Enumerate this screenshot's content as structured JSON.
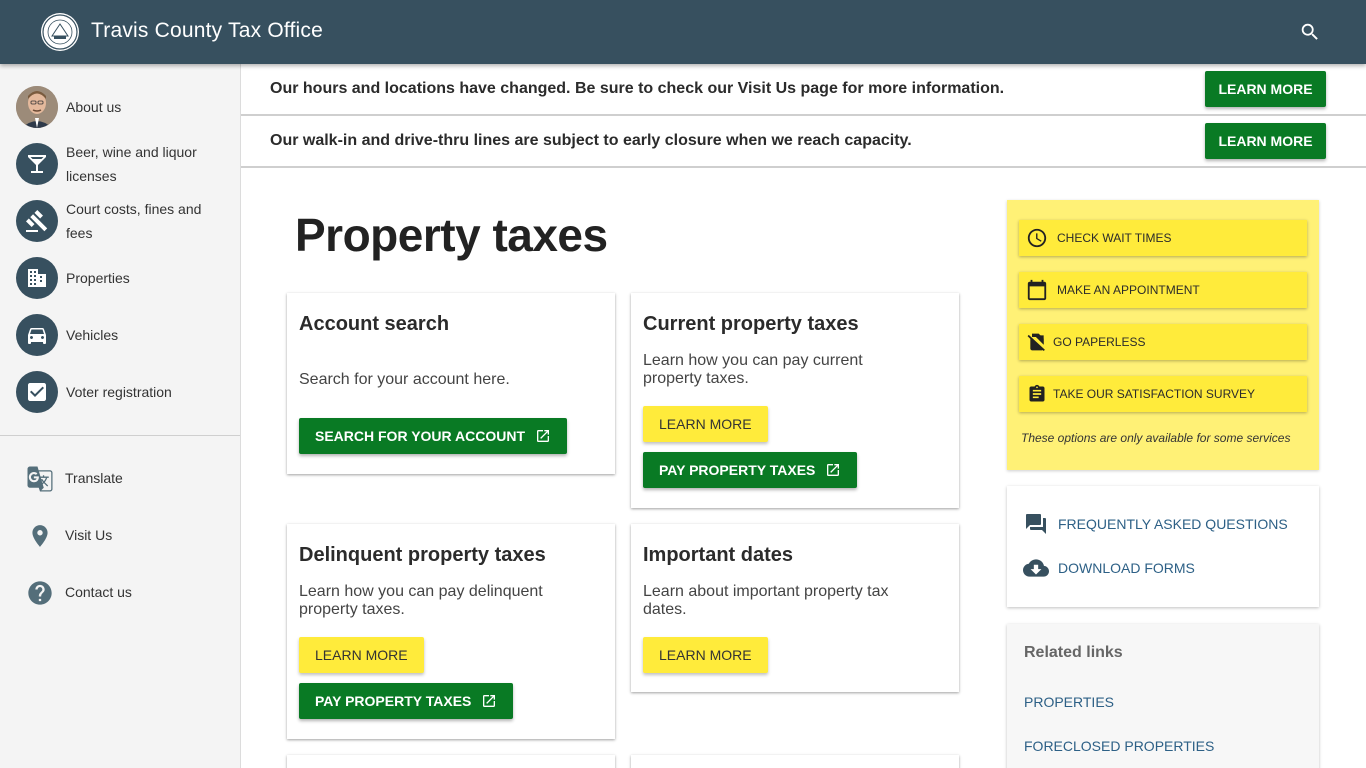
{
  "header": {
    "title": "Travis County Tax Office",
    "seal_icon": "county-seal-icon",
    "search_icon": "search-icon",
    "bg_color": "#37505f"
  },
  "sidebar": {
    "items": [
      {
        "label": "About us",
        "icon": "avatar-photo"
      },
      {
        "label": "Beer, wine and liquor licenses",
        "icon": "cocktail-glass-icon"
      },
      {
        "label": "Court costs, fines and fees",
        "icon": "gavel-icon"
      },
      {
        "label": "Properties",
        "icon": "building-icon"
      },
      {
        "label": "Vehicles",
        "icon": "car-icon"
      },
      {
        "label": "Voter registration",
        "icon": "checkbox-icon"
      }
    ],
    "utilities": [
      {
        "label": "Translate",
        "icon": "translate-icon"
      },
      {
        "label": "Visit Us",
        "icon": "location-pin-icon"
      },
      {
        "label": "Contact us",
        "icon": "help-circle-icon"
      }
    ]
  },
  "alerts": [
    {
      "text": "Our hours and locations have changed. Be sure to check our Visit Us page for more information.",
      "button": "LEARN MORE"
    },
    {
      "text": "Our walk-in and drive-thru lines are subject to early closure when we reach capacity.",
      "button": "LEARN MORE"
    }
  ],
  "main": {
    "title": "Property taxes",
    "cards": [
      {
        "title": "Account search",
        "desc": "Search for your account here.",
        "green_button": "SEARCH FOR YOUR ACCOUNT"
      },
      {
        "title": "Current property taxes",
        "desc": "Learn how you can pay current property taxes.",
        "yellow_button": "LEARN MORE",
        "green_button": "PAY PROPERTY TAXES"
      },
      {
        "title": "Delinquent property taxes",
        "desc": "Learn how you can pay delinquent property taxes.",
        "yellow_button": "LEARN MORE",
        "green_button": "PAY PROPERTY TAXES"
      },
      {
        "title": "Important dates",
        "desc": "Learn about important property tax dates.",
        "yellow_button": "LEARN MORE"
      }
    ]
  },
  "quick_actions": {
    "buttons": [
      {
        "label": "CHECK WAIT TIMES",
        "icon": "clock-icon"
      },
      {
        "label": "MAKE AN APPOINTMENT",
        "icon": "calendar-icon"
      },
      {
        "label": "GO PAPERLESS",
        "icon": "paperless-icon"
      },
      {
        "label": "TAKE OUR SATISFACTION SURVEY",
        "icon": "clipboard-icon"
      }
    ],
    "note": "These options are only available for some services"
  },
  "resources": [
    {
      "label": "FREQUENTLY ASKED QUESTIONS",
      "icon": "forum-icon"
    },
    {
      "label": "DOWNLOAD FORMS",
      "icon": "cloud-download-icon"
    }
  ],
  "related": {
    "title": "Related links",
    "links": [
      "PROPERTIES",
      "FORECLOSED PROPERTIES"
    ]
  },
  "colors": {
    "primary": "#37505f",
    "green": "#097a24",
    "yellow": "#ffeb3b",
    "link": "#2d6086"
  }
}
